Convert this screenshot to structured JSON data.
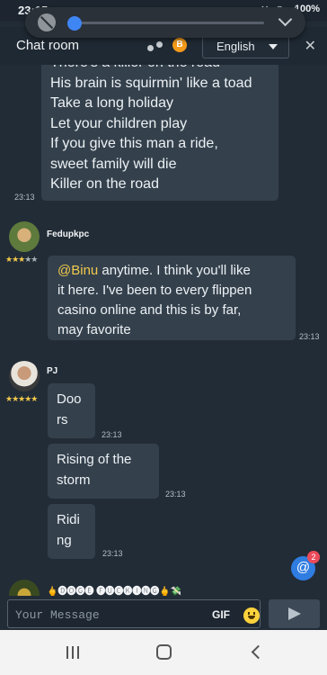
{
  "status_bar": {
    "time": "23:15",
    "icons": "✕ ◉ ▲",
    "battery": "100%"
  },
  "volume": {
    "level": 0.03
  },
  "header": {
    "title": "Chat room",
    "language": "English",
    "coin_label": "B",
    "close": "✕"
  },
  "messages": [
    {
      "lines": [
        "There's a killer on the road",
        "His brain is squirmin' like a toad",
        "Take a long holiday",
        "Let your children play",
        "If you give this man a ride,",
        "sweet family will die",
        "Killer on the road"
      ],
      "time": "23:13"
    },
    {
      "user": "Fedupkpc",
      "rating": 3,
      "mention": "@Binu",
      "text_first": " anytime. I think you'll like",
      "text_rest": [
        "it here. I've been to every flippen",
        "casino online and this is by far,",
        "may favorite"
      ],
      "time": "23:13"
    },
    {
      "user": "PJ",
      "rating": 5,
      "bubbles": [
        {
          "lines": [
            "Doo",
            "rs"
          ],
          "time": "23:13"
        },
        {
          "lines": [
            "Rising of the",
            "storm"
          ],
          "time": "23:13"
        },
        {
          "lines": [
            "Ridi",
            "ng"
          ],
          "time": "23:13"
        }
      ]
    },
    {
      "user": "🖕🅓🅞🅖🅔 🅕🅤🅒🅚🅘🅝🅖🖕💸"
    }
  ],
  "scroll_button": {
    "icon": "@",
    "unread": "2"
  },
  "composer": {
    "placeholder": "Your Message",
    "gif": "GIF"
  }
}
